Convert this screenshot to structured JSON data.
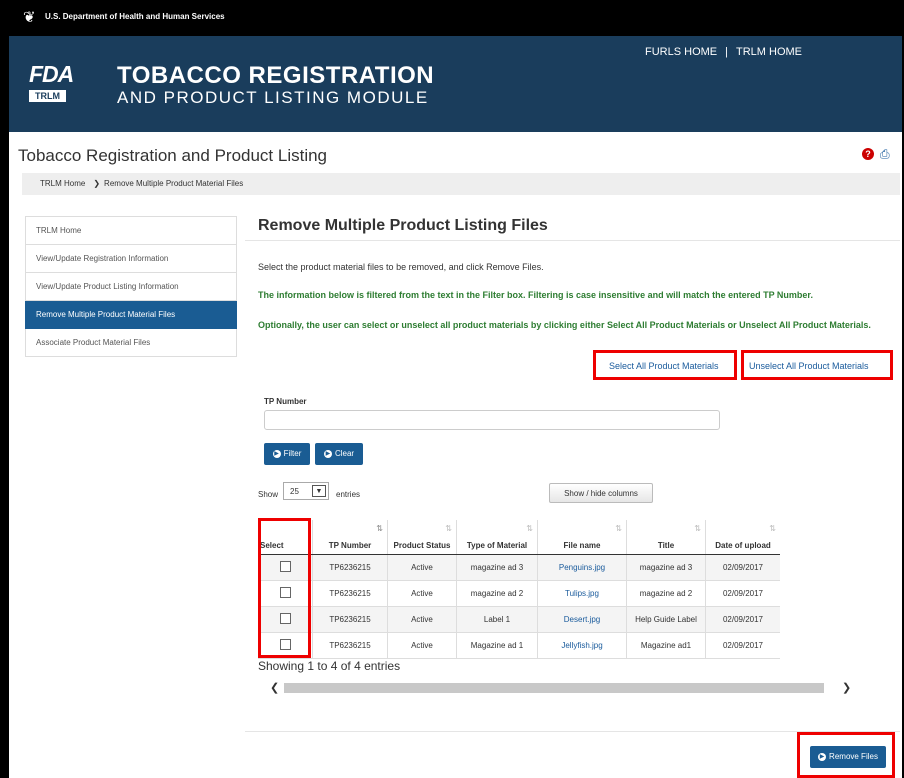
{
  "topbar": {
    "agency": "U.S. Department of Health and Human Services",
    "icon": "hhs-eagle-icon"
  },
  "header": {
    "logo_text": "FDA",
    "logo_badge": "TRLM",
    "title": "TOBACCO REGISTRATION",
    "subtitle": "AND PRODUCT LISTING MODULE",
    "nav": {
      "furls_home": "FURLS HOME",
      "separator": "|",
      "trlm_home": "TRLM HOME"
    }
  },
  "page": {
    "title": "Tobacco Registration and Product Listing",
    "help_icon": "?",
    "print_icon": "print-icon"
  },
  "breadcrumb": {
    "home": "TRLM Home",
    "separator": "❯",
    "current": "Remove Multiple Product Material Files"
  },
  "sidebar": {
    "items": [
      {
        "label": "TRLM Home",
        "active": false
      },
      {
        "label": "View/Update Registration Information",
        "active": false
      },
      {
        "label": "View/Update Product Listing Information",
        "active": false
      },
      {
        "label": "Remove Multiple Product Material Files",
        "active": true
      },
      {
        "label": "Associate Product Material Files",
        "active": false
      }
    ]
  },
  "main": {
    "title": "Remove Multiple Product Listing Files",
    "instruction": "Select the product material files to be removed, and click Remove Files.",
    "filter_note": "The information below is filtered from the text in the Filter box. Filtering is case insensitive and will match the entered TP Number.",
    "select_note": "Optionally, the user can select or unselect all product materials by clicking either Select All Product Materials or Unselect All Product Materials.",
    "select_all": "Select All Product Materials",
    "unselect_all": "Unselect All Product Materials",
    "tp_label": "TP Number",
    "tp_value": "",
    "filter_button": "Filter",
    "clear_button": "Clear",
    "show_label": "Show",
    "page_length": "25",
    "entries_label": "entries",
    "columns_button": "Show / hide columns",
    "showing": "Showing 1 to 4 of 4 entries",
    "remove_button": "Remove Files"
  },
  "table": {
    "headers": [
      "Select",
      "TP Number",
      "Product Status",
      "Type of Material",
      "File name",
      "Title",
      "Date of upload"
    ],
    "rows": [
      {
        "checked": false,
        "tp": "TP6236215",
        "status": "Active",
        "type": "magazine ad 3",
        "file": "Penguins.jpg",
        "title": "magazine ad 3",
        "date": "02/09/2017"
      },
      {
        "checked": false,
        "tp": "TP6236215",
        "status": "Active",
        "type": "magazine ad 2",
        "file": "Tulips.jpg",
        "title": "magazine ad 2",
        "date": "02/09/2017"
      },
      {
        "checked": false,
        "tp": "TP6236215",
        "status": "Active",
        "type": "Label 1",
        "file": "Desert.jpg",
        "title": "Help Guide Label",
        "date": "02/09/2017"
      },
      {
        "checked": false,
        "tp": "TP6236215",
        "status": "Active",
        "type": "Magazine ad 1",
        "file": "Jellyfish.jpg",
        "title": "Magazine ad1",
        "date": "02/09/2017"
      }
    ]
  },
  "colors": {
    "header": "#1a3d5c",
    "accent": "#1a5c93",
    "note_green": "#2e7d32",
    "highlight_red": "#ee0000"
  }
}
